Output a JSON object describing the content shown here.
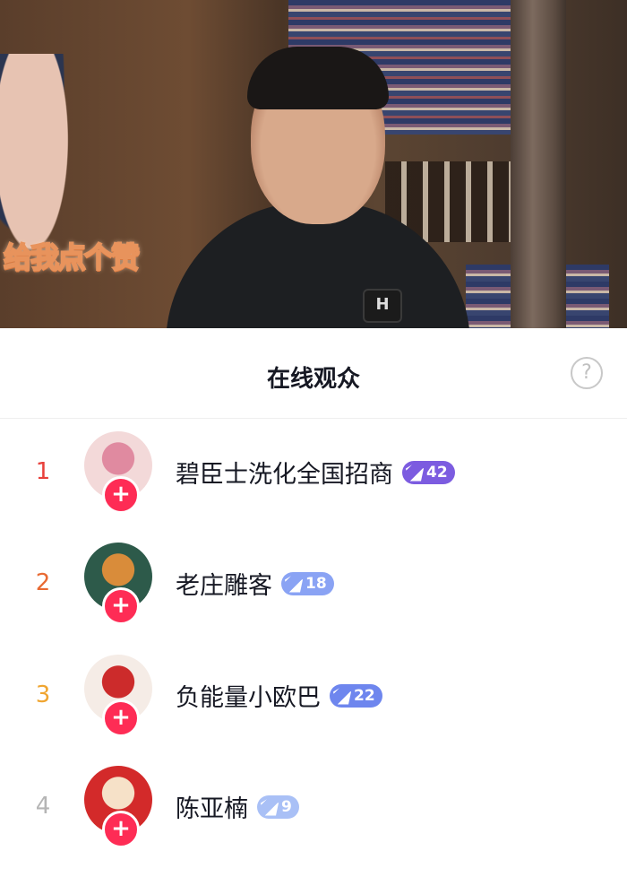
{
  "video": {
    "sticker_text": "给我点个赞",
    "mic_logo": "H"
  },
  "panel": {
    "title": "在线观众",
    "help_icon": "?"
  },
  "viewers": [
    {
      "rank": "1",
      "name": "碧臣士洗化全国招商",
      "level": "42",
      "rank_color": "#e8403b",
      "badge_color": "#7c5ce0",
      "avatar_colors": [
        "#f3d9d9",
        "#e08aa0"
      ],
      "follow_icon": "+"
    },
    {
      "rank": "2",
      "name": "老庄雕客",
      "level": "18",
      "rank_color": "#e86a33",
      "badge_color": "#8aa3f4",
      "avatar_colors": [
        "#2d5a4a",
        "#d98c3a"
      ],
      "follow_icon": "+"
    },
    {
      "rank": "3",
      "name": "负能量小欧巴",
      "level": "22",
      "rank_color": "#f0a530",
      "badge_color": "#6e86ee",
      "avatar_colors": [
        "#f5ece6",
        "#cc2b2b"
      ],
      "follow_icon": "+"
    },
    {
      "rank": "4",
      "name": "陈亚楠",
      "level": "9",
      "rank_color": "#b5b5b5",
      "badge_color": "#a9c0f6",
      "avatar_colors": [
        "#d32a2a",
        "#f6e1c8"
      ],
      "follow_icon": "+"
    }
  ]
}
